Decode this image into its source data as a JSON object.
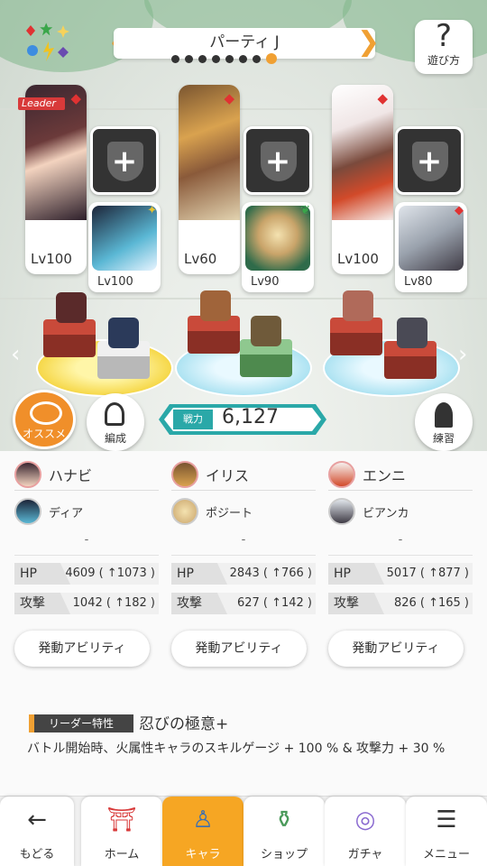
{
  "header": {
    "party_title": "パーティ J",
    "help_label": "遊び方",
    "page_count": 8,
    "active_page": 8,
    "colors": {
      "accent": "#f0a033",
      "fire": "#e03232"
    }
  },
  "party": [
    {
      "leader_label": "Leader",
      "main_level": "Lv100",
      "main_element": "fire",
      "sub_level": "Lv100",
      "sub_element": "light"
    },
    {
      "main_level": "Lv60",
      "main_element": "fire",
      "sub_level": "Lv90",
      "sub_element": "wind"
    },
    {
      "main_level": "Lv100",
      "main_element": "fire",
      "sub_level": "Lv80",
      "sub_element": "fire"
    }
  ],
  "actions": {
    "recommend_label": "オススメ",
    "formation_label": "編成",
    "practice_label": "練習",
    "power_label": "戦力",
    "power_value": "6,127"
  },
  "columns": [
    {
      "main_name": "ハナビ",
      "sub_name": "ディア",
      "slot": "-",
      "hp_label": "HP",
      "hp": "4609 ( ↑1073 )",
      "atk_label": "攻撃",
      "atk": "1042 ( ↑182 )",
      "ability_label": "発動アビリティ"
    },
    {
      "main_name": "イリス",
      "sub_name": "ポジート",
      "slot": "-",
      "hp_label": "HP",
      "hp": "2843 ( ↑766 )",
      "atk_label": "攻撃",
      "atk": "627 ( ↑142 )",
      "ability_label": "発動アビリティ"
    },
    {
      "main_name": "エンニ",
      "sub_name": "ビアンカ",
      "slot": "-",
      "hp_label": "HP",
      "hp": "5017 ( ↑877 )",
      "atk_label": "攻撃",
      "atk": "826 ( ↑165 )",
      "ability_label": "発動アビリティ"
    }
  ],
  "leader_trait": {
    "tag": "リーダー特性",
    "name": "忍びの極意+",
    "description": "バトル開始時、火属性キャラのスキルゲージ + 100 % & 攻撃力 + 30 %"
  },
  "nav": {
    "back": "もどる",
    "home": "ホーム",
    "chara": "キャラ",
    "shop": "ショップ",
    "gacha": "ガチャ",
    "menu": "メニュー",
    "active": "chara"
  }
}
